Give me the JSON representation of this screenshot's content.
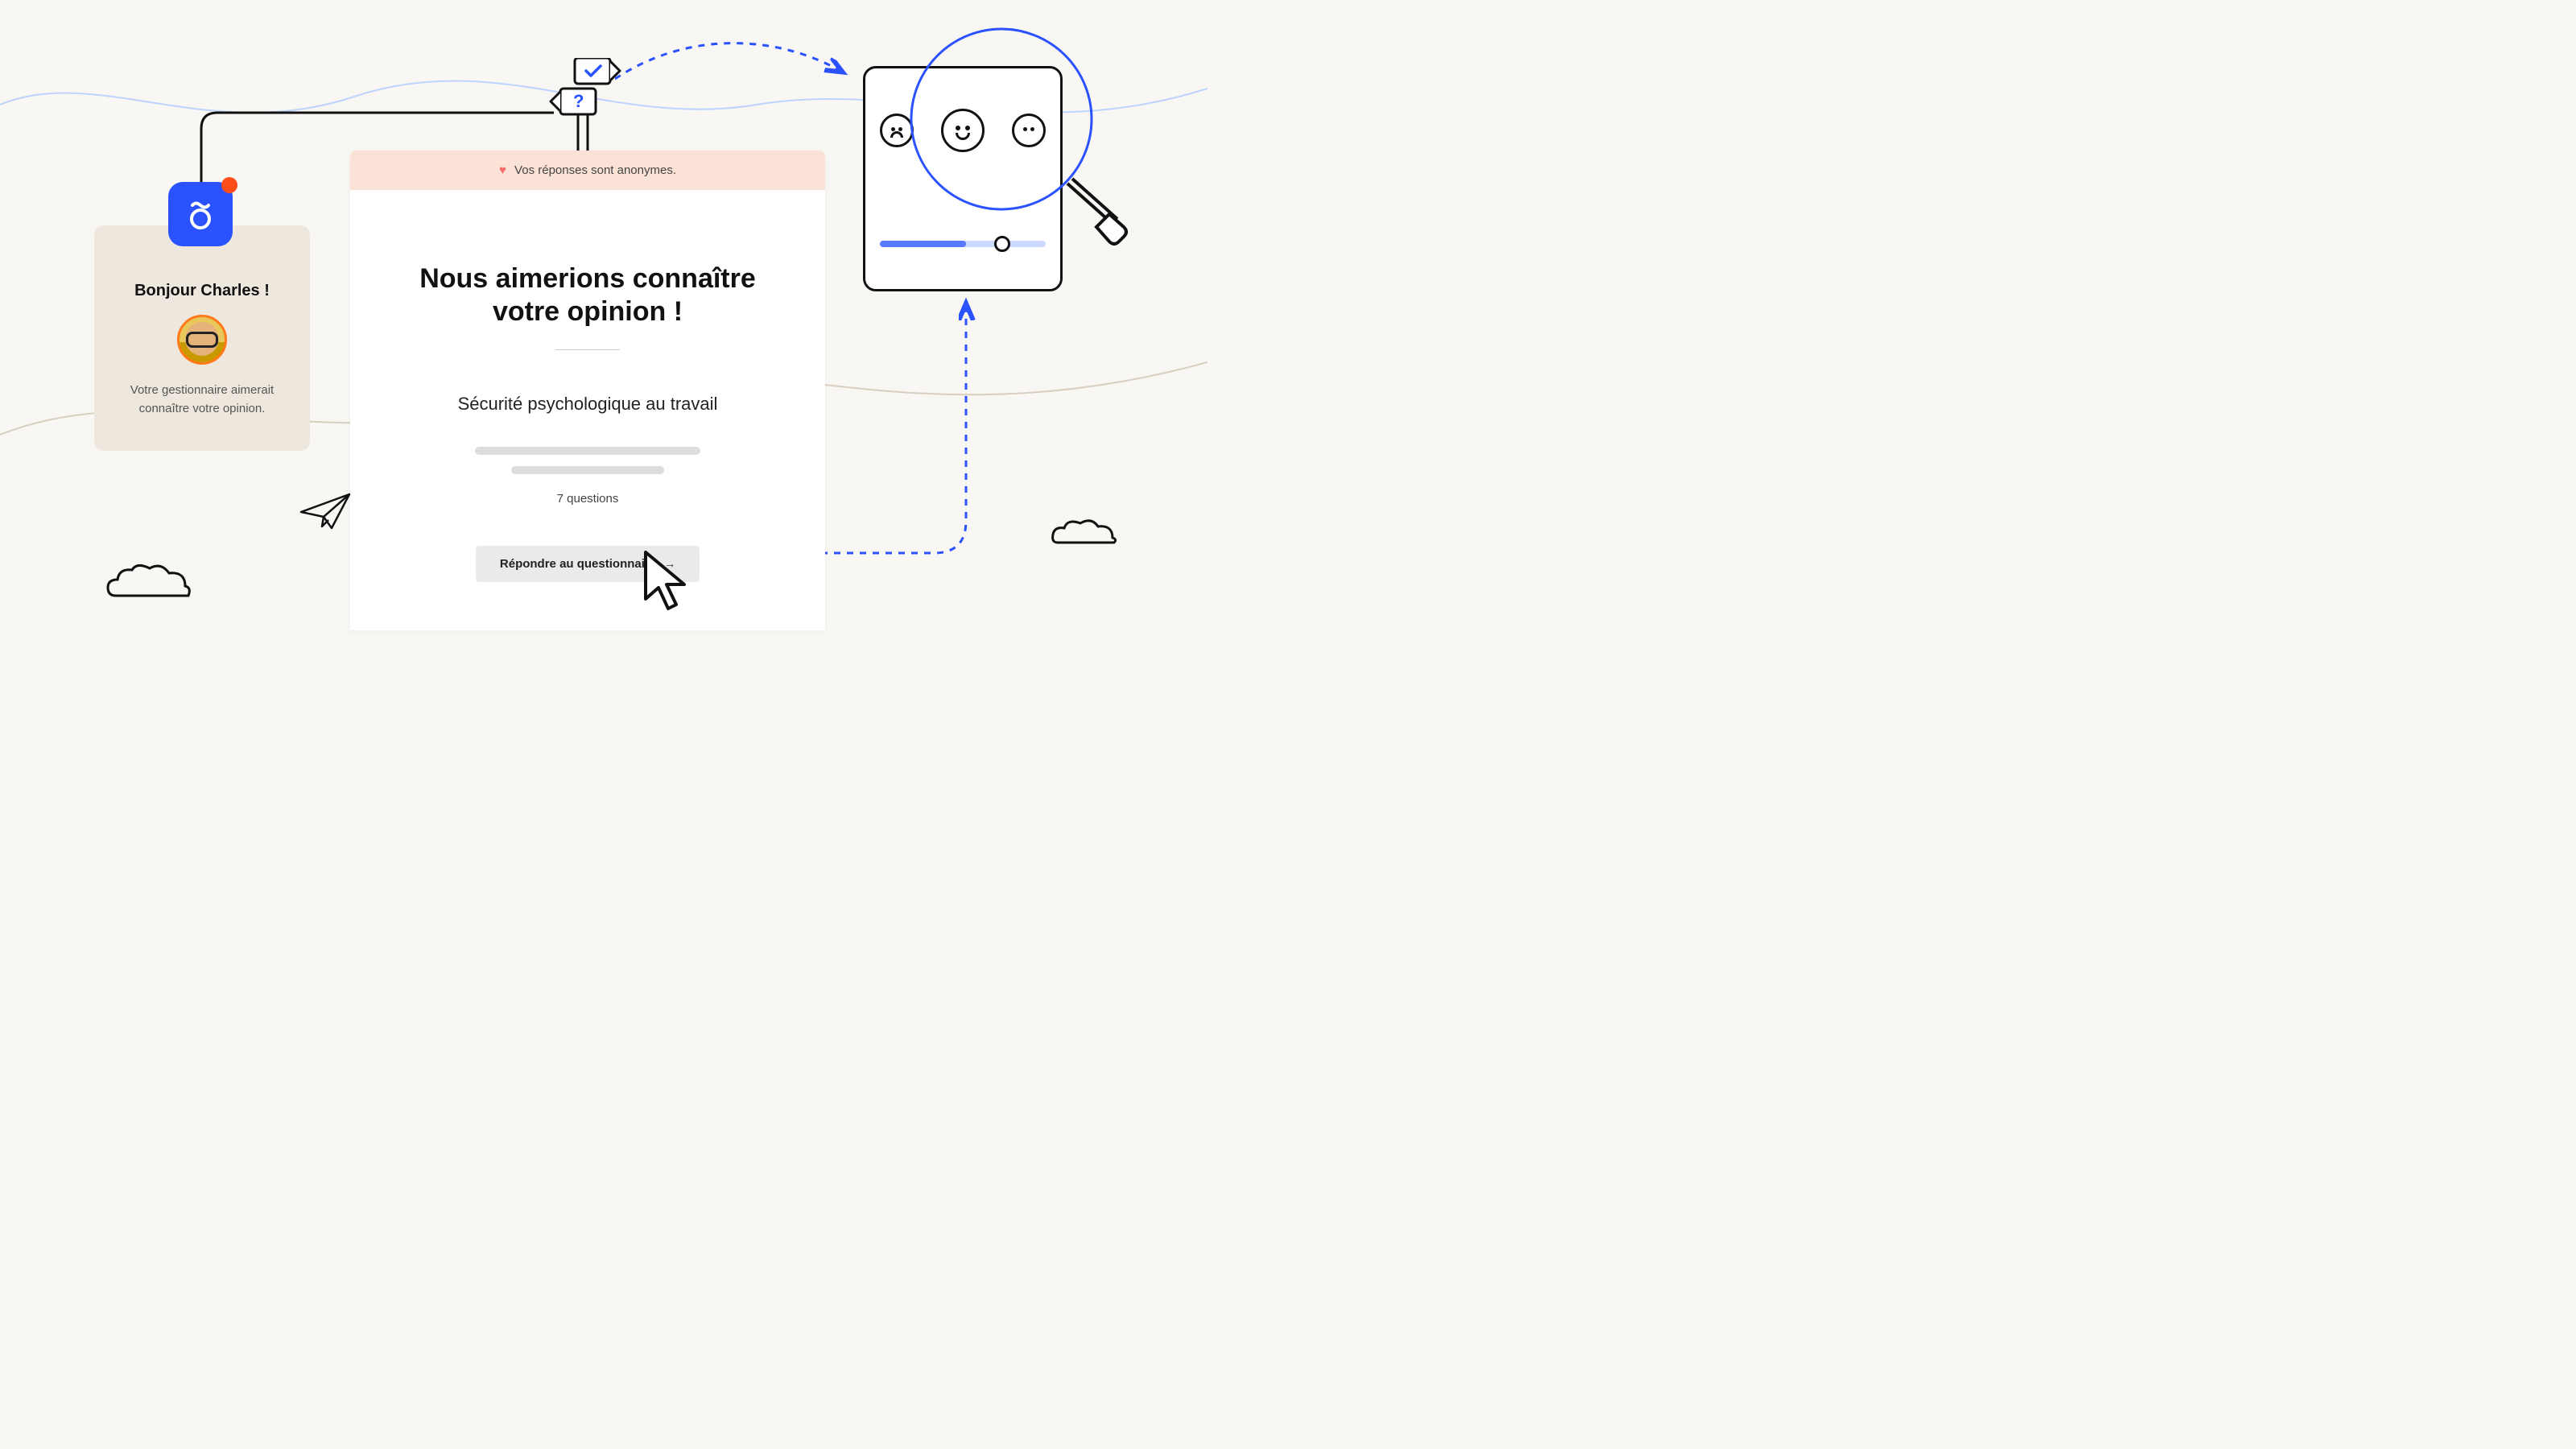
{
  "greeting": {
    "heading": "Bonjour  Charles !",
    "body": "Votre gestionnaire aimerait connaître votre opinion."
  },
  "survey": {
    "banner_text": "Vos réponses sont anonymes.",
    "title_line1": "Nous aimerions connaître",
    "title_line2": "votre opinion !",
    "topic": "Sécurité psychologique au travail",
    "question_count": "7 questions",
    "button_label": "Répondre au questionnaire"
  },
  "signpost": {
    "up_symbol": "✓",
    "down_symbol": "?"
  },
  "icons": {
    "heart": "♥",
    "arrow_right": "→"
  },
  "colors": {
    "primary_blue": "#2a52ff",
    "accent_orange": "#ff4d1a",
    "banner_peach": "#fbe2d6",
    "card_beige": "#eee7de"
  }
}
